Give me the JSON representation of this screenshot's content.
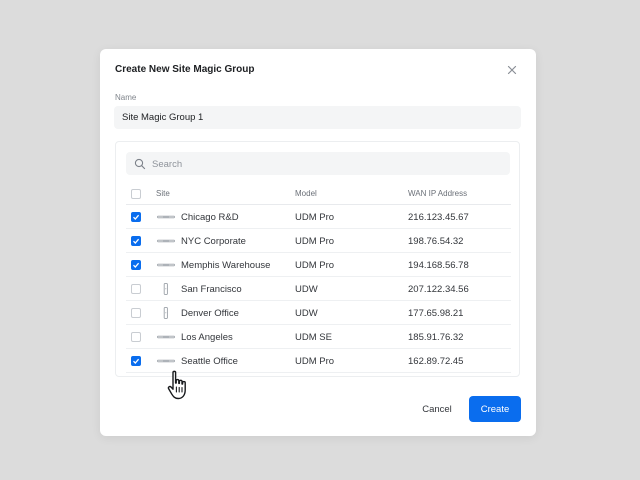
{
  "dialog": {
    "title": "Create New Site Magic Group",
    "name_label": "Name",
    "name_value": "Site Magic Group 1",
    "search_placeholder": "Search",
    "columns": {
      "site": "Site",
      "model": "Model",
      "wan_ip": "WAN IP Address"
    },
    "rows": [
      {
        "site": "Chicago R&D",
        "model": "UDM Pro",
        "ip": "216.123.45.67",
        "checked": true,
        "device_icon": "rack-device-icon"
      },
      {
        "site": "NYC Corporate",
        "model": "UDM Pro",
        "ip": "198.76.54.32",
        "checked": true,
        "device_icon": "rack-device-icon"
      },
      {
        "site": "Memphis Warehouse",
        "model": "UDM Pro",
        "ip": "194.168.56.78",
        "checked": true,
        "device_icon": "rack-device-icon"
      },
      {
        "site": "San Francisco",
        "model": "UDW",
        "ip": "207.122.34.56",
        "checked": false,
        "device_icon": "wall-device-icon"
      },
      {
        "site": "Denver Office",
        "model": "UDW",
        "ip": "177.65.98.21",
        "checked": false,
        "device_icon": "wall-device-icon"
      },
      {
        "site": "Los Angeles",
        "model": "UDM SE",
        "ip": "185.91.76.32",
        "checked": false,
        "device_icon": "rack-device-icon"
      },
      {
        "site": "Seattle Office",
        "model": "UDM Pro",
        "ip": "162.89.72.45",
        "checked": true,
        "device_icon": "rack-device-icon"
      }
    ],
    "cancel_label": "Cancel",
    "create_label": "Create"
  },
  "colors": {
    "accent": "#0a6dee",
    "backdrop": "#dcdcdc"
  },
  "icons": {
    "close": "close-icon",
    "search": "search-icon",
    "cursor": "hand-pointer-icon"
  }
}
